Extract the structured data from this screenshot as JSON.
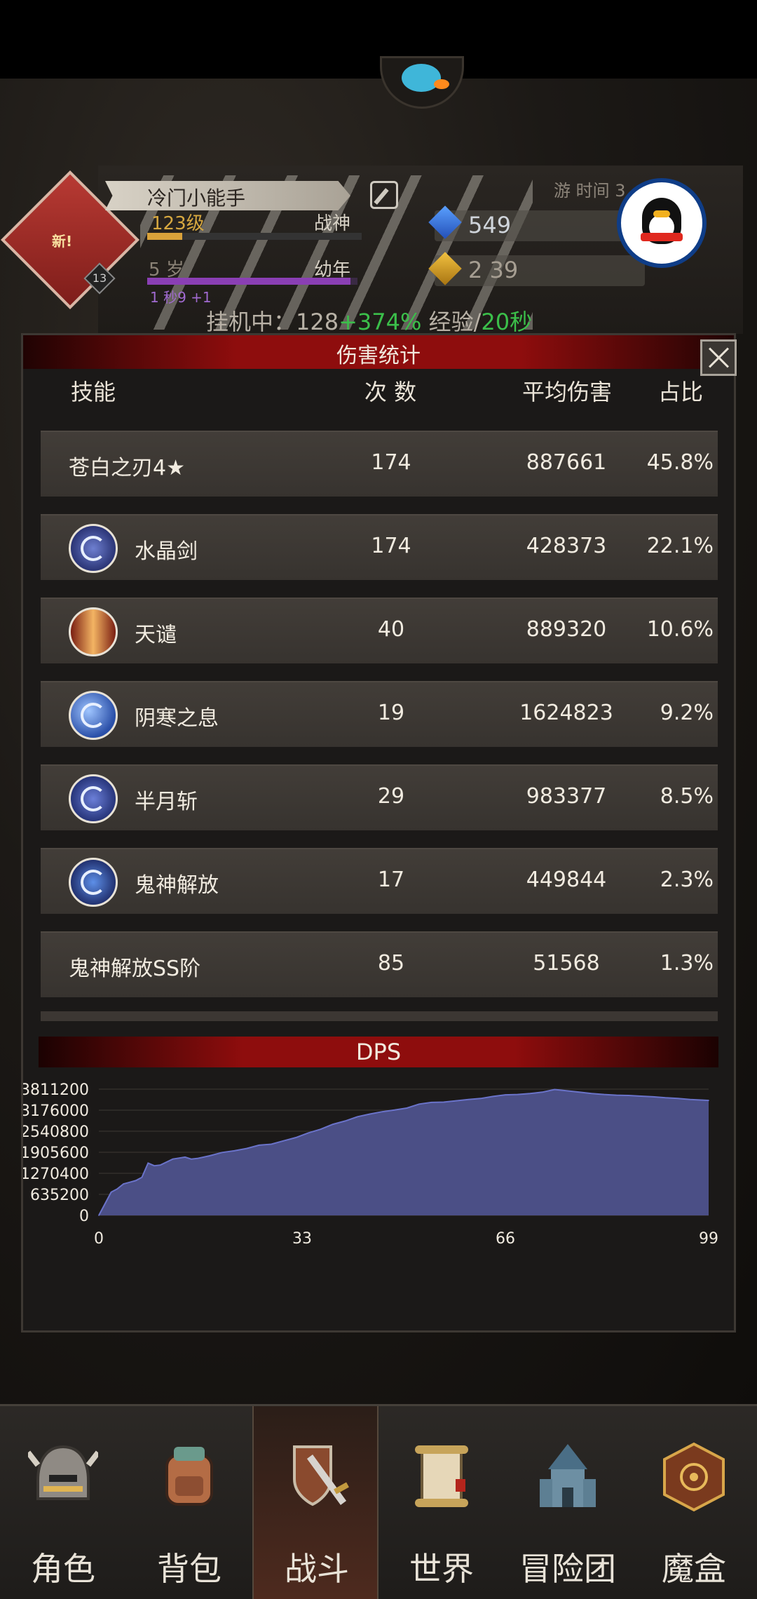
{
  "player": {
    "name": "冷门小能手",
    "level": "123级",
    "title": "战神",
    "age": "5 岁",
    "age_stage": "幼年",
    "life_text": "1 秒9 +1",
    "edit_icon": "edit-icon",
    "badge_text": "新!",
    "badge_num": "13",
    "play_time": "游 时间 3"
  },
  "resources": {
    "gems": "549",
    "gold": "2 39"
  },
  "idle": {
    "prefix": "挂机中：128",
    "bonus": "+374%",
    "mid": " 经验/",
    "rate": "20秒"
  },
  "modal": {
    "title": "伤害统计",
    "close_icon": "close-icon",
    "headers": {
      "skill": "技能",
      "count": "次 数",
      "avg": "平均伤害",
      "ratio": "占比"
    },
    "rows": [
      {
        "name": "苍白之刃4★",
        "count": "174",
        "avg": "887661",
        "ratio": "45.8%",
        "icon": ""
      },
      {
        "name": "水晶剑",
        "count": "174",
        "avg": "428373",
        "ratio": "22.1%",
        "icon": "crystal-sword-icon"
      },
      {
        "name": "天谴",
        "count": "40",
        "avg": "889320",
        "ratio": "10.6%",
        "icon": "heaven-punishment-icon"
      },
      {
        "name": "阴寒之息",
        "count": "19",
        "avg": "1624823",
        "ratio": "9.2%",
        "icon": "frost-breath-icon"
      },
      {
        "name": "半月斩",
        "count": "29",
        "avg": "983377",
        "ratio": "8.5%",
        "icon": "half-moon-slash-icon"
      },
      {
        "name": "鬼神解放",
        "count": "17",
        "avg": "449844",
        "ratio": "2.3%",
        "icon": "ghost-release-icon"
      },
      {
        "name": "鬼神解放SS阶",
        "count": "85",
        "avg": "51568",
        "ratio": "1.3%",
        "icon": ""
      }
    ],
    "dps_title": "DPS"
  },
  "chart_data": {
    "type": "area",
    "title": "DPS",
    "xlabel": "",
    "ylabel": "",
    "xlim": [
      0,
      99
    ],
    "ylim": [
      0,
      3811200
    ],
    "x_ticks": [
      0,
      33,
      66,
      99
    ],
    "y_ticks": [
      0,
      635200,
      1270400,
      1905600,
      2540800,
      3176000,
      3811200
    ],
    "grid": true,
    "fill_color": "#4b4f86",
    "line_color": "#6a73c9",
    "x": [
      0,
      1,
      2,
      3,
      4,
      5,
      6,
      7,
      8,
      9,
      10,
      12,
      13,
      14,
      15,
      16,
      18,
      20,
      22,
      24,
      26,
      28,
      30,
      32,
      34,
      36,
      38,
      40,
      42,
      44,
      46,
      48,
      50,
      52,
      54,
      56,
      58,
      60,
      62,
      64,
      66,
      68,
      70,
      72,
      74,
      76,
      78,
      80,
      82,
      84,
      86,
      88,
      90,
      92,
      94,
      96,
      98,
      99
    ],
    "values": [
      0,
      350000,
      700000,
      800000,
      950000,
      1000000,
      1050000,
      1150000,
      1580000,
      1500000,
      1520000,
      1700000,
      1730000,
      1760000,
      1700000,
      1720000,
      1800000,
      1900000,
      1950000,
      2020000,
      2120000,
      2150000,
      2250000,
      2350000,
      2490000,
      2600000,
      2750000,
      2850000,
      2980000,
      3060000,
      3130000,
      3180000,
      3240000,
      3360000,
      3410000,
      3420000,
      3460000,
      3500000,
      3530000,
      3590000,
      3640000,
      3650000,
      3680000,
      3720000,
      3800000,
      3760000,
      3720000,
      3680000,
      3650000,
      3630000,
      3620000,
      3600000,
      3580000,
      3550000,
      3530000,
      3500000,
      3480000,
      3470000
    ]
  },
  "nav": [
    {
      "label": "角色",
      "icon": "helmet-icon"
    },
    {
      "label": "背包",
      "icon": "backpack-icon"
    },
    {
      "label": "战斗",
      "icon": "sword-shield-icon"
    },
    {
      "label": "世界",
      "icon": "scroll-map-icon"
    },
    {
      "label": "冒险团",
      "icon": "castle-icon"
    },
    {
      "label": "魔盒",
      "icon": "magic-box-icon"
    }
  ],
  "nav_active": "战斗"
}
